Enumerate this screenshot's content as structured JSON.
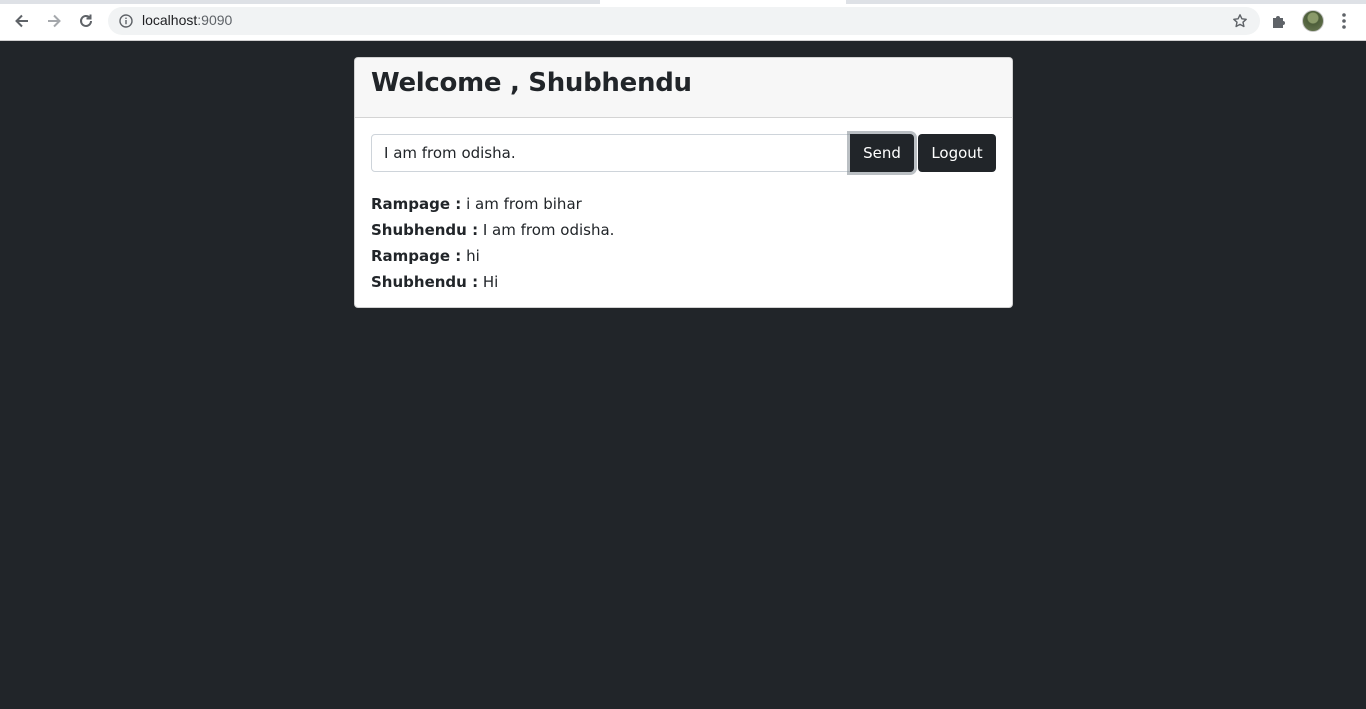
{
  "browser": {
    "url_host": "localhost",
    "url_port": ":9090"
  },
  "card": {
    "title": "Welcome , Shubhendu"
  },
  "composer": {
    "input_value": "I am from odisha.",
    "send_label": "Send",
    "logout_label": "Logout"
  },
  "messages": [
    {
      "sender": "Rampage :",
      "text": " i am from bihar"
    },
    {
      "sender": "Shubhendu :",
      "text": " I am from odisha."
    },
    {
      "sender": "Rampage :",
      "text": " hi"
    },
    {
      "sender": "Shubhendu :",
      "text": " Hi"
    }
  ],
  "colors": {
    "page_background": "#212529",
    "button_background": "#212529",
    "card_header_background": "#f7f7f7"
  },
  "icons": {
    "back": "arrow-left-icon",
    "forward": "arrow-right-icon",
    "reload": "reload-icon",
    "site_info": "info-icon",
    "bookmark": "star-icon",
    "extensions": "puzzle-icon",
    "profile": "avatar",
    "menu": "kebab-menu-icon"
  }
}
